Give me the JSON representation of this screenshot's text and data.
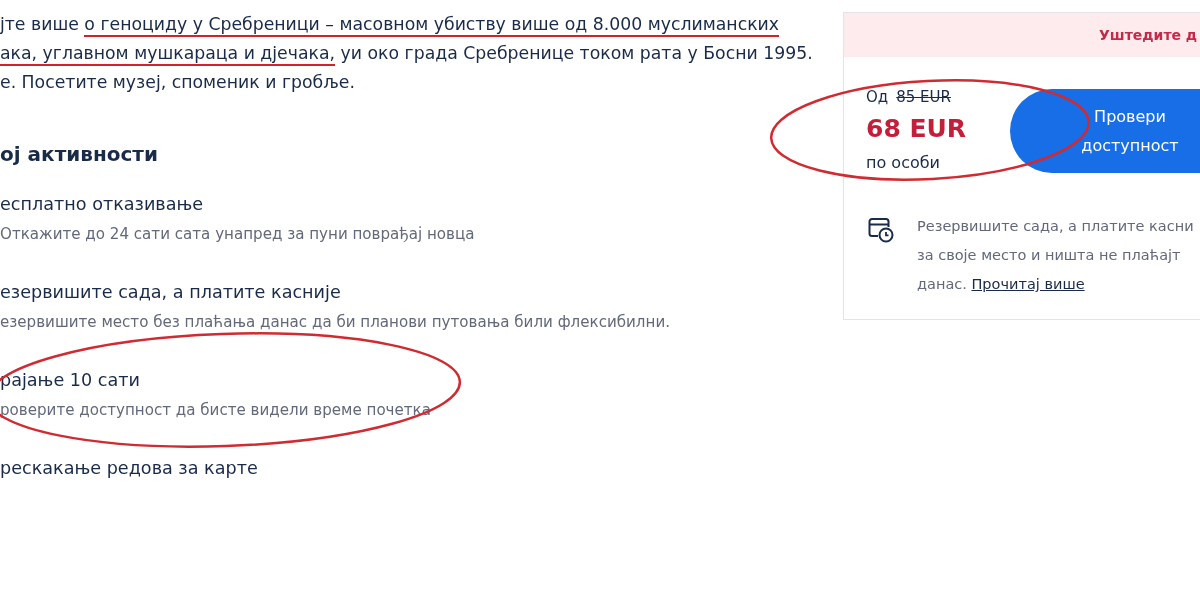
{
  "intro_lines": [
    [
      {
        "text": "јте више ",
        "underlined": false
      },
      {
        "text": "о геноциду у Сребреници – масовном убиству више од 8.000 муслиманских",
        "underlined": true
      }
    ],
    [
      {
        "text": "ака, углавном мушкараца и дјечака,",
        "underlined": true
      },
      {
        "text": " уи око града Сребренице током рата у Босни 1995.",
        "underlined": false
      }
    ],
    [
      {
        "text": "е. Посетите музеј, споменик и гробље.",
        "underlined": false
      }
    ]
  ],
  "section_heading": "ој активности",
  "features": [
    {
      "title": "есплатно отказивање",
      "description": "Откажите до 24 сати сата унапред за пуни поврађај новца",
      "circled": false
    },
    {
      "title": "езервишите сада, а платите касније",
      "description": "езервишите место без плаћања данас да би планови путовања били флексибилни.",
      "circled": false
    },
    {
      "title": "рајање 10 сати",
      "description": "роверите доступност да бисте видели време почетка",
      "circled": true
    },
    {
      "title": "рескакање редова за карте",
      "circled": false
    }
  ],
  "booking_card": {
    "banner": "Уштедите д",
    "price": {
      "prefix": "Од",
      "original": "85 EUR",
      "current": "68 EUR",
      "unit": "по особи",
      "circled": true
    },
    "button": "Провери доступност",
    "reserve_note": {
      "lines": [
        "Резервишите сада, а платите касни",
        "за своје место и ништа не плаћајт",
        "данас."
      ],
      "link": "Прочитај више"
    }
  }
}
